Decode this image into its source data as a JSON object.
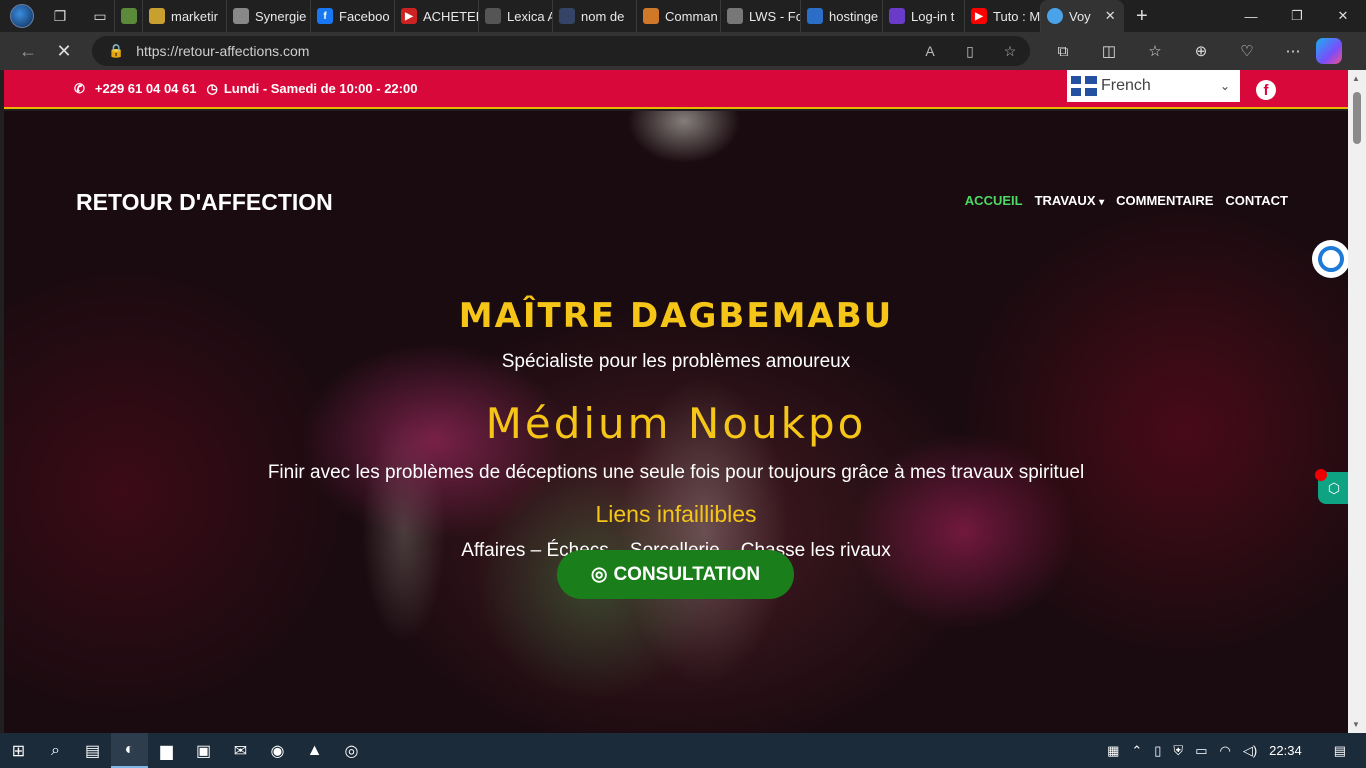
{
  "browser": {
    "tabs": [
      {
        "label": "marketir",
        "color": "#c8a030"
      },
      {
        "label": "Synergie",
        "color": "#888888"
      },
      {
        "label": "Faceboo",
        "color": "#1877f2"
      },
      {
        "label": "ACHETER",
        "color": "#cc2222"
      },
      {
        "label": "Lexica A",
        "color": "#555555"
      },
      {
        "label": "nom de",
        "color": "#334466"
      },
      {
        "label": "Comman",
        "color": "#d0782a"
      },
      {
        "label": "LWS - Fo",
        "color": "#777777"
      },
      {
        "label": "hostinge",
        "color": "#2a6ec8"
      },
      {
        "label": "Log-in t",
        "color": "#6a3ac8"
      },
      {
        "label": "Tuto : M",
        "color": "#ff0000"
      },
      {
        "label": "Voy",
        "color": "#4aa3e8"
      }
    ],
    "url": "https://retour-affections.com"
  },
  "topbar": {
    "phone": "+229 61 04 04 61",
    "hours": "Lundi - Samedi de 10:00 - 22:00",
    "language": "French"
  },
  "header": {
    "brand": "RETOUR D'AFFECTION",
    "nav": [
      "ACCUEIL",
      "TRAVAUX",
      "COMMENTAIRE",
      "CONTACT"
    ]
  },
  "hero": {
    "name": "MAÎTRE DAGBEMABU",
    "specialty": "Spécialiste pour les problèmes amoureux",
    "medium": "Médium Noukpo",
    "description": "Finir avec les problèmes de déceptions une seule fois pour toujours grâce à mes travaux spirituel",
    "liens": "Liens infaillibles",
    "services": "Affaires – Échecs – Sorcellerie – Chasse les rivaux",
    "cta": "CONSULTATION"
  },
  "taskbar": {
    "time": "22:34"
  },
  "colors": {
    "topbar": "#d9083a",
    "accent_gold": "#f5c518",
    "nav_active": "#4cd964",
    "cta": "#1a7f1a"
  }
}
